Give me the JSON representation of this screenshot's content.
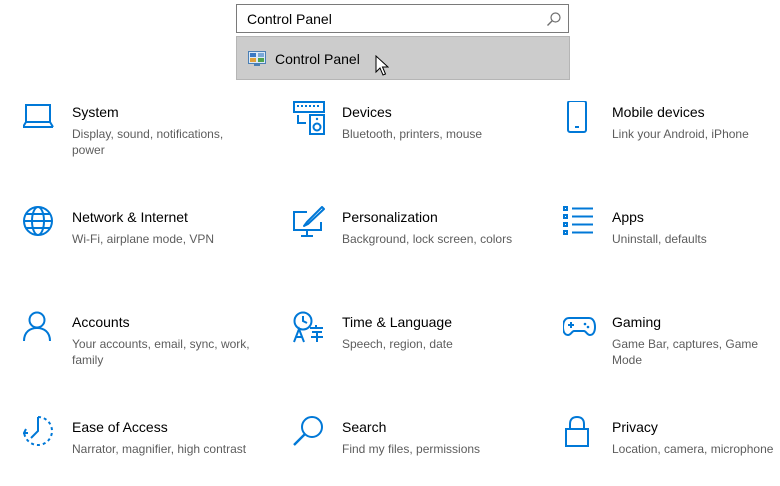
{
  "search": {
    "value": "Control Panel",
    "suggestion": "Control Panel"
  },
  "tiles": {
    "system": {
      "title": "System",
      "desc": "Display, sound, notifications, power"
    },
    "devices": {
      "title": "Devices",
      "desc": "Bluetooth, printers, mouse"
    },
    "mobile": {
      "title": "Mobile devices",
      "desc": "Link your Android, iPhone"
    },
    "network": {
      "title": "Network & Internet",
      "desc": "Wi-Fi, airplane mode, VPN"
    },
    "personalization": {
      "title": "Personalization",
      "desc": "Background, lock screen, colors"
    },
    "apps": {
      "title": "Apps",
      "desc": "Uninstall, defaults"
    },
    "accounts": {
      "title": "Accounts",
      "desc": "Your accounts, email, sync, work, family"
    },
    "time": {
      "title": "Time & Language",
      "desc": "Speech, region, date"
    },
    "gaming": {
      "title": "Gaming",
      "desc": "Game Bar, captures, Game Mode"
    },
    "ease": {
      "title": "Ease of Access",
      "desc": "Narrator, magnifier, high contrast"
    },
    "search": {
      "title": "Search",
      "desc": "Find my files, permissions"
    },
    "privacy": {
      "title": "Privacy",
      "desc": "Location, camera, microphone"
    }
  },
  "icons": {
    "system": "laptop-icon",
    "devices": "keyboard-speaker-icon",
    "mobile": "phone-icon",
    "network": "globe-icon",
    "personalization": "paint-monitor-icon",
    "apps": "list-icon",
    "accounts": "person-icon",
    "time": "time-language-icon",
    "gaming": "gamepad-icon",
    "ease": "ease-of-access-icon",
    "search": "magnifier-icon",
    "privacy": "padlock-icon"
  },
  "colors": {
    "accent": "#0078d7",
    "suggestion_bg": "#cccccc"
  }
}
